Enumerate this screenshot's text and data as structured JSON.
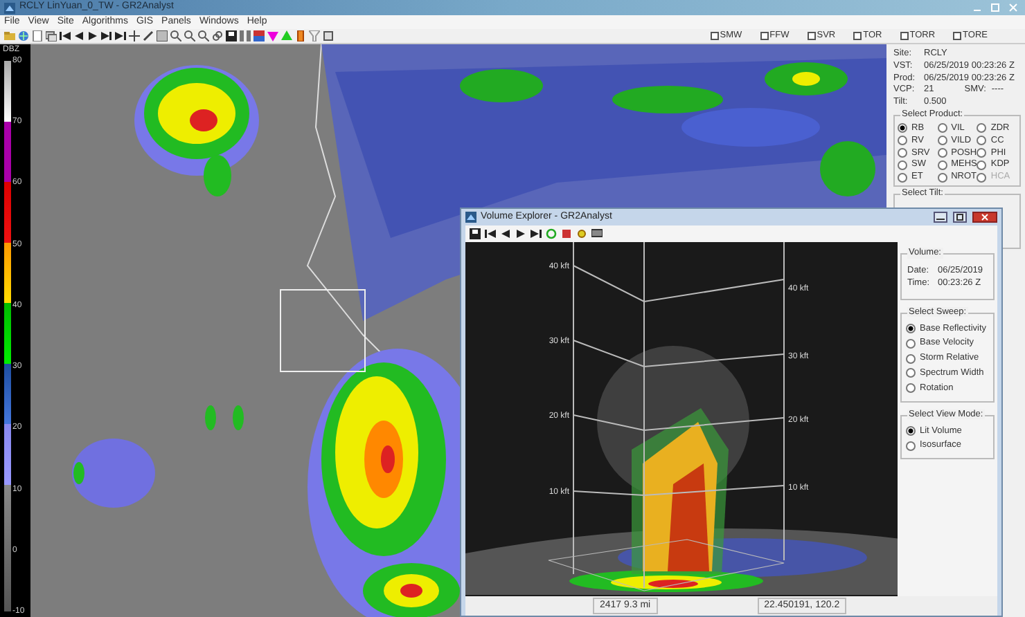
{
  "window": {
    "title": "RCLY LinYuan_0_TW - GR2Analyst"
  },
  "menu": [
    "File",
    "View",
    "Site",
    "Algorithms",
    "GIS",
    "Panels",
    "Windows",
    "Help"
  ],
  "warning_toggles": [
    {
      "label": "SMW",
      "checked": false
    },
    {
      "label": "FFW",
      "checked": false
    },
    {
      "label": "SVR",
      "checked": false
    },
    {
      "label": "TOR",
      "checked": false
    },
    {
      "label": "TORR",
      "checked": false
    },
    {
      "label": "TORE",
      "checked": false
    }
  ],
  "color_scale": {
    "unit": "DBZ",
    "labels": [
      "80",
      "70",
      "60",
      "50",
      "40",
      "30",
      "20",
      "10",
      "0",
      "-10"
    ]
  },
  "info": [
    {
      "label": "Site:",
      "value": "RCLY"
    },
    {
      "label": "VST:",
      "value": "06/25/2019  00:23:26 Z"
    },
    {
      "label": "Prod:",
      "value": "06/25/2019  00:23:26 Z"
    },
    {
      "label": "VCP:",
      "value": "21",
      "extra_label": "SMV:",
      "extra_value": "----"
    },
    {
      "label": "Tilt:",
      "value": "0.500"
    }
  ],
  "product_panel": {
    "title": "Select Product:",
    "products": [
      {
        "label": "RB",
        "selected": true,
        "disabled": false
      },
      {
        "label": "VIL",
        "selected": false,
        "disabled": false
      },
      {
        "label": "ZDR",
        "selected": false,
        "disabled": false
      },
      {
        "label": "RV",
        "selected": false,
        "disabled": false
      },
      {
        "label": "VILD",
        "selected": false,
        "disabled": false
      },
      {
        "label": "CC",
        "selected": false,
        "disabled": false
      },
      {
        "label": "SRV",
        "selected": false,
        "disabled": false
      },
      {
        "label": "POSH",
        "selected": false,
        "disabled": false
      },
      {
        "label": "PHI",
        "selected": false,
        "disabled": false
      },
      {
        "label": "SW",
        "selected": false,
        "disabled": false
      },
      {
        "label": "MEHS",
        "selected": false,
        "disabled": false
      },
      {
        "label": "KDP",
        "selected": false,
        "disabled": false
      },
      {
        "label": "ET",
        "selected": false,
        "disabled": false
      },
      {
        "label": "NROT",
        "selected": false,
        "disabled": false
      },
      {
        "label": "HCA",
        "selected": false,
        "disabled": true
      }
    ]
  },
  "tilt_panel": {
    "title": "Select Tilt:"
  },
  "volume_explorer": {
    "title": "Volume Explorer - GR2Analyst",
    "left_altitude_labels": [
      "40 kft",
      "30 kft",
      "20 kft",
      "10 kft"
    ],
    "right_altitude_labels": [
      "40 kft",
      "30 kft",
      "20 kft",
      "10 kft"
    ],
    "volume": {
      "title": "Volume:",
      "date_label": "Date:",
      "date": "06/25/2019",
      "time_label": "Time:",
      "time": "00:23:26 Z"
    },
    "sweep_panel": {
      "title": "Select Sweep:",
      "options": [
        {
          "label": "Base Reflectivity",
          "selected": true
        },
        {
          "label": "Base Velocity",
          "selected": false
        },
        {
          "label": "Storm Relative",
          "selected": false
        },
        {
          "label": "Spectrum Width",
          "selected": false
        },
        {
          "label": "Rotation",
          "selected": false
        }
      ]
    },
    "view_mode_panel": {
      "title": "Select View Mode:",
      "options": [
        {
          "label": "Lit Volume",
          "selected": true
        },
        {
          "label": "Isosurface",
          "selected": false
        }
      ]
    },
    "status_bar": [
      "2417 9.3 mi",
      "22.450191, 120.2"
    ]
  }
}
